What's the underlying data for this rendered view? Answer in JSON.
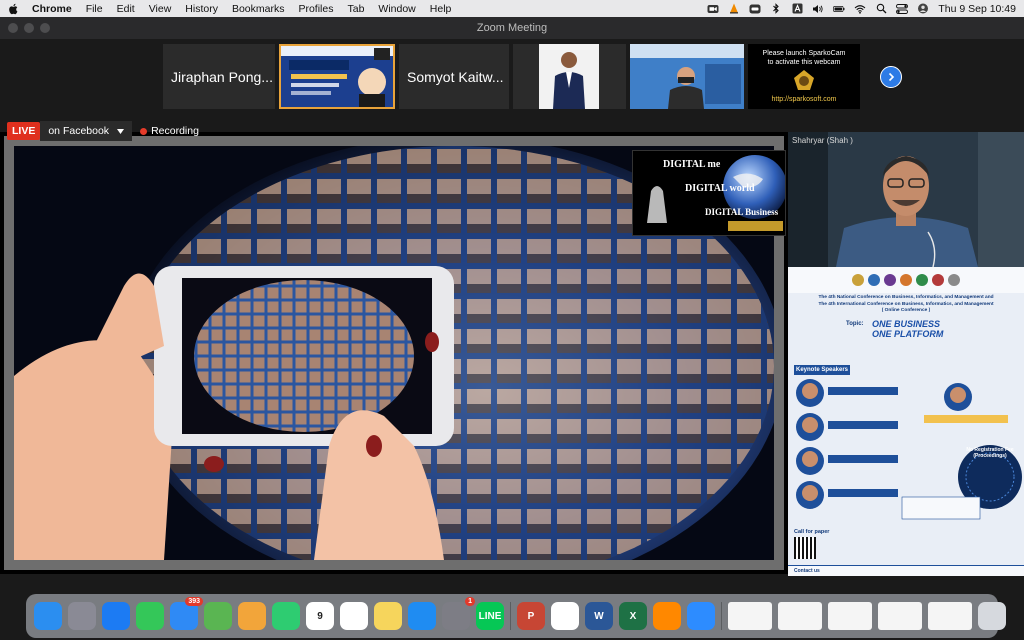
{
  "menubar": {
    "app": "Chrome",
    "items": [
      "File",
      "Edit",
      "View",
      "History",
      "Bookmarks",
      "Profiles",
      "Tab",
      "Window",
      "Help"
    ],
    "clock": "Thu 9 Sep  10:49"
  },
  "window": {
    "title": "Zoom Meeting"
  },
  "participants": {
    "tiles": [
      {
        "kind": "name",
        "name": "Jiraphan Pong..."
      },
      {
        "kind": "poster"
      },
      {
        "kind": "name",
        "name": "Somyot Kaitw..."
      },
      {
        "kind": "video"
      },
      {
        "kind": "video"
      },
      {
        "kind": "webcam-notice",
        "line1": "Please launch SparkoCam",
        "line2": "to activate this webcam",
        "url": "http://sparkosoft.com"
      }
    ]
  },
  "livebar": {
    "live": "LIVE",
    "destination": "on Facebook",
    "recording": "Recording"
  },
  "speaker": {
    "name": "Shahryar (Shah )"
  },
  "slide_inset": {
    "line1": "DIGITAL me",
    "line2": "DIGITAL world",
    "line3": "DIGITAL Business"
  },
  "poster": {
    "heading1": "The 4th National Conference on Business, Informatics, and Management and",
    "heading2": "The 4th International Conference on Business, Informatics, and Management",
    "heading3": "( Online Conference )",
    "topic_label": "Topic:",
    "topic_line1": "ONE BUSINESS",
    "topic_line2": "ONE PLATFORM",
    "keynote": "Keynote Speakers",
    "no_fee": "No Registration Fee (Proceedings)",
    "call": "Call for paper",
    "contact": "Contact us"
  },
  "dock": {
    "apps": [
      {
        "name": "finder",
        "color": "#2b8ef0"
      },
      {
        "name": "launchpad",
        "color": "#8a8a95"
      },
      {
        "name": "safari",
        "color": "#1c7bf3"
      },
      {
        "name": "messages",
        "color": "#34c759"
      },
      {
        "name": "mail",
        "color": "#2f8af5",
        "badge": "393"
      },
      {
        "name": "maps",
        "color": "#5ab552"
      },
      {
        "name": "photos",
        "color": "#f2a53a"
      },
      {
        "name": "facetime",
        "color": "#2ecc71"
      },
      {
        "name": "calendar",
        "color": "#ffffff",
        "label": "9"
      },
      {
        "name": "reminders",
        "color": "#ffffff"
      },
      {
        "name": "notes",
        "color": "#f6d55c"
      },
      {
        "name": "app-store",
        "color": "#1f8cf2"
      },
      {
        "name": "system-preferences",
        "color": "#7d7d85",
        "badge": "1"
      },
      {
        "name": "line",
        "color": "#06c755",
        "label": "LINE"
      },
      {
        "name": "powerpoint",
        "color": "#c74634",
        "label": "P"
      },
      {
        "name": "chrome",
        "color": "#ffffff"
      },
      {
        "name": "word",
        "color": "#2b5797",
        "label": "W"
      },
      {
        "name": "excel",
        "color": "#1e7145",
        "label": "X"
      },
      {
        "name": "vlc",
        "color": "#ff8800"
      },
      {
        "name": "zoom",
        "color": "#2d8cff"
      }
    ]
  },
  "colors": {
    "accent": "#2d7be6",
    "live": "#e0301e",
    "recording": "#e53b2a"
  }
}
